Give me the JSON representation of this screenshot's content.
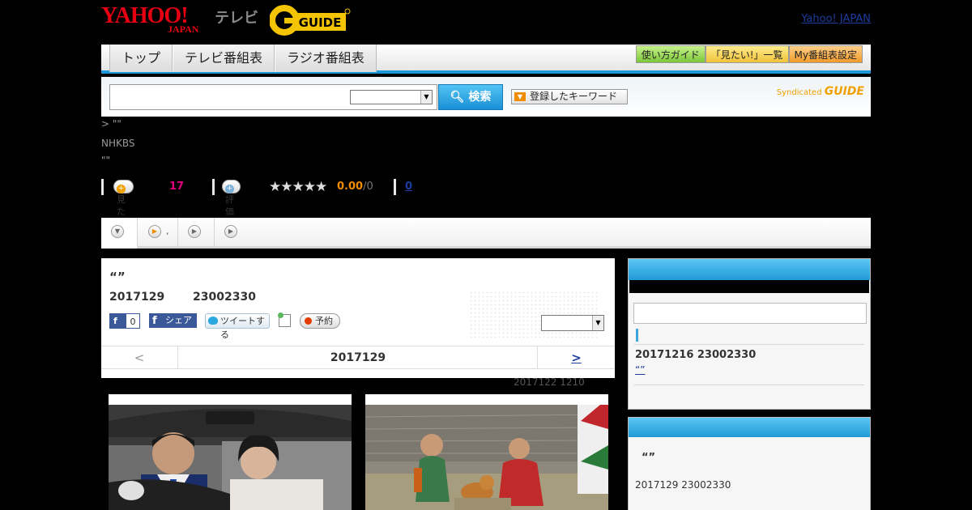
{
  "header": {
    "yahoo_logo": "YAHOO!",
    "yahoo_sub": "JAPAN",
    "tv_label": "テレビ",
    "gguide_logo": "G-GUIDE",
    "top_link": "Yahoo! JAPAN"
  },
  "nav": {
    "tabs": [
      {
        "label": "トップ"
      },
      {
        "label": "テレビ番組表"
      },
      {
        "label": "ラジオ番組表"
      }
    ],
    "buttons": [
      {
        "label": "使い方ガイド"
      },
      {
        "label": "「見たい!」一覧"
      },
      {
        "label": "My番組表設定"
      }
    ]
  },
  "search": {
    "input_value": "",
    "select_value": "",
    "button_label": "検索",
    "keyword_button": "登録したキーワード",
    "syndicated": "Syndicated",
    "syndicated_brand": "GUIDE"
  },
  "info": {
    "breadcrumb": "> \"\"",
    "channel": "NHKBS",
    "program": "\"\""
  },
  "ratings": {
    "mitai_label": "見たい!",
    "mitai_count": "17",
    "rate_label": "評価",
    "stars": "★★★★★",
    "score": "0.00",
    "score_total": "/0",
    "review_count": "0"
  },
  "program_tabs": [
    {
      "label": ""
    },
    {
      "label": ","
    },
    {
      "label": ""
    },
    {
      "label": ""
    }
  ],
  "main": {
    "title": "“”",
    "date": "2017129",
    "time": "23002330",
    "fb_like_label": "f",
    "fb_like_count": "0",
    "fb_share_label": "シェア",
    "tweet_label": "ツイートする",
    "reserve_label": "予約",
    "select_value": "",
    "pager_prev": "<",
    "pager_current": "2017129",
    "pager_next": ">"
  },
  "updated": "2017122  1210",
  "sidebar": {
    "next_date": "20171216  23002330",
    "next_link": "“”",
    "section2_title": "“”",
    "section2_date": "2017129  23002330"
  }
}
